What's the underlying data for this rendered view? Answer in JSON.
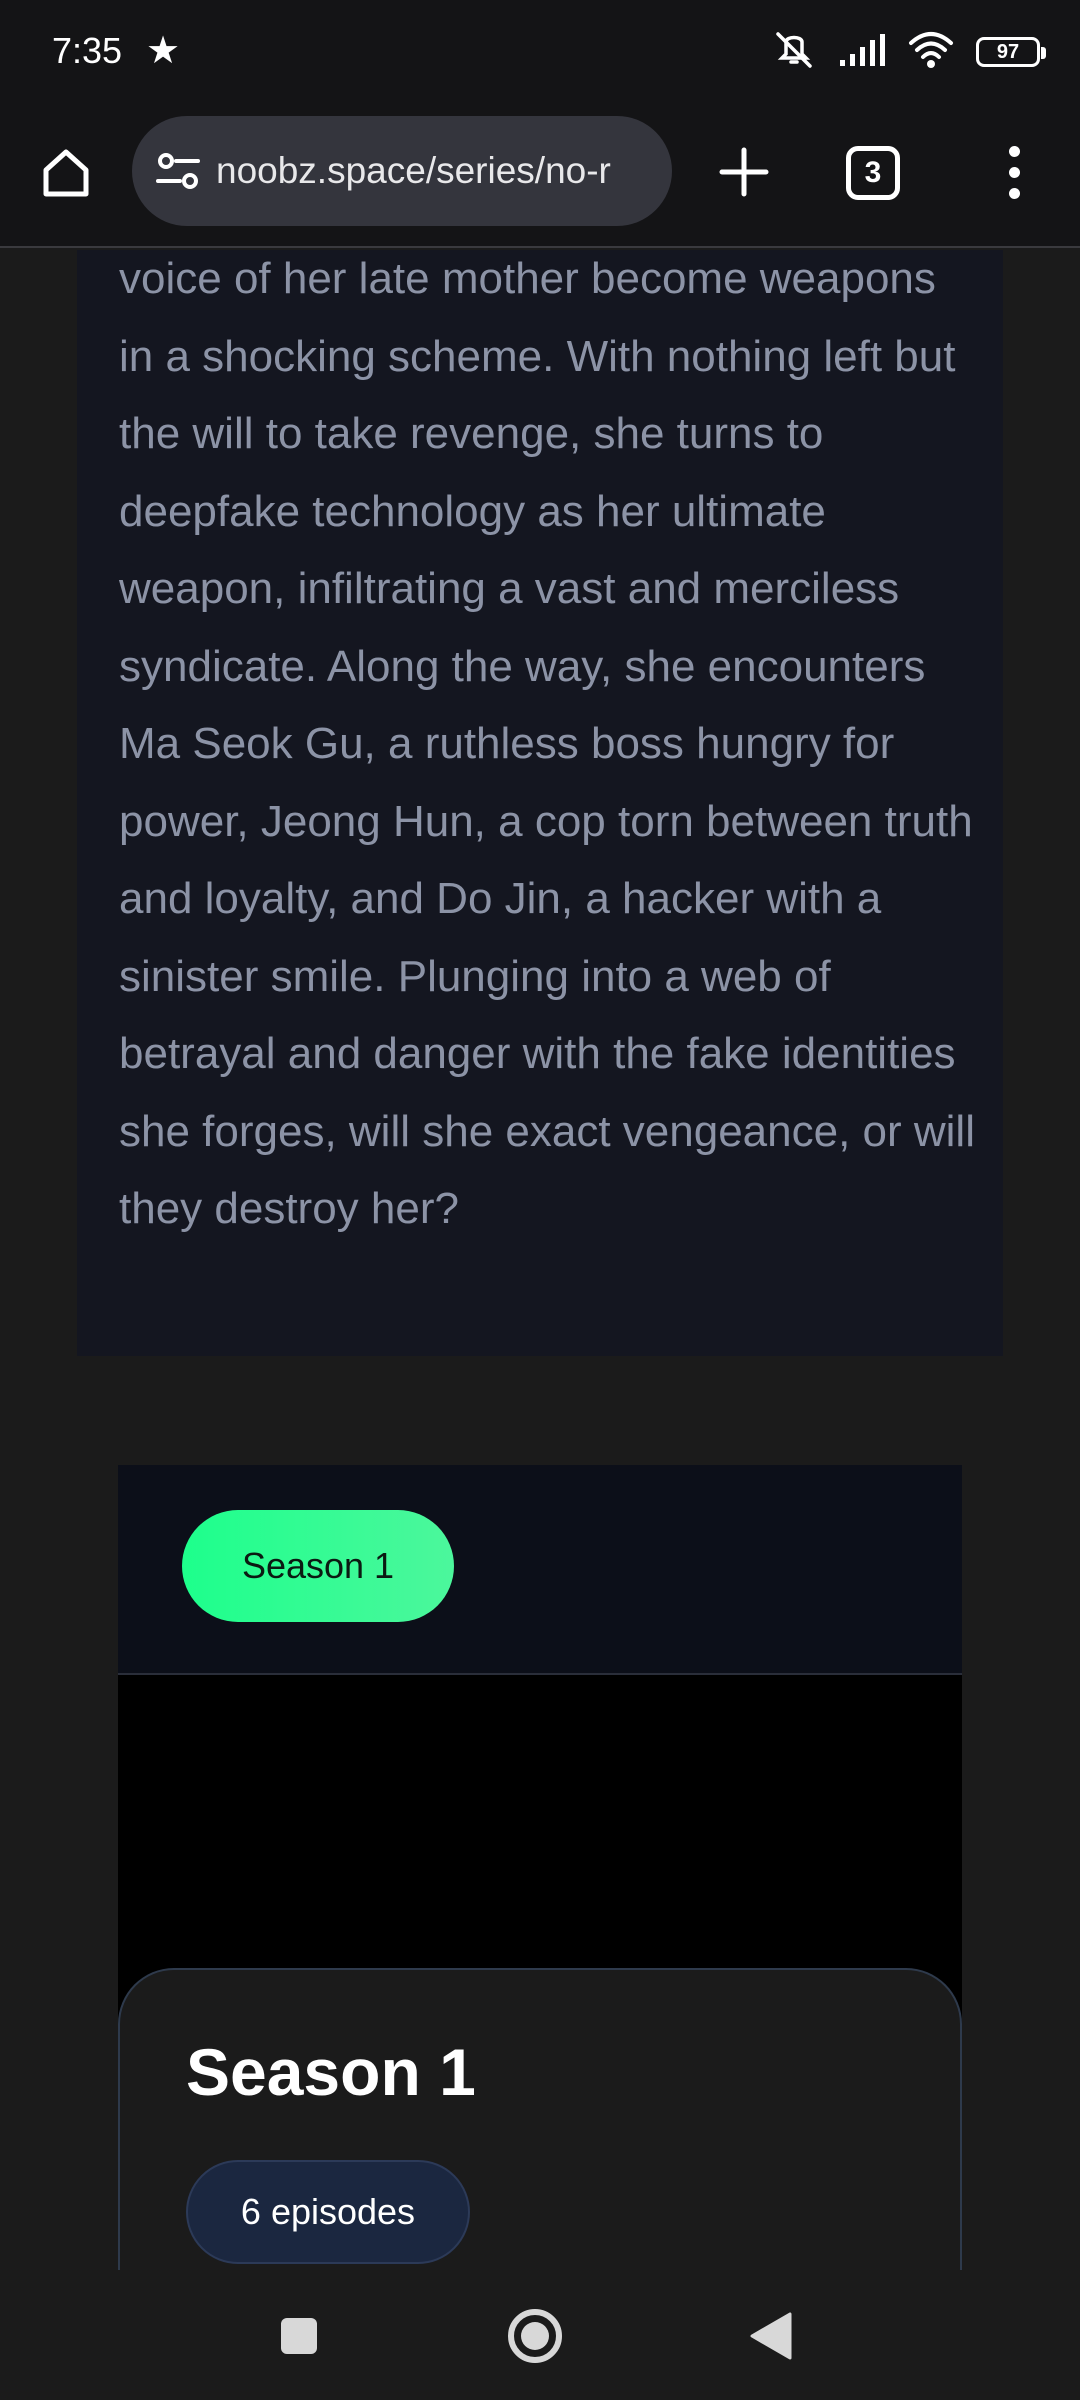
{
  "status_bar": {
    "time": "7:35",
    "battery": "97",
    "icons": [
      "star-icon",
      "vibrate-off-icon",
      "signal-icon",
      "wifi-icon",
      "battery-icon"
    ]
  },
  "toolbar": {
    "url": "noobz.space/series/no-r",
    "tab_count": "3",
    "icons": [
      "home-icon",
      "site-settings-icon",
      "new-tab-plus-icon",
      "tab-switcher-icon",
      "more-menu-icon"
    ]
  },
  "synopsis": {
    "text": "voice of her late mother become weapons in a shocking scheme. With nothing left but the will to take revenge, she turns to deepfake technology as her ultimate weapon, infiltrating a vast and merciless syndicate. Along the way, she encounters Ma Seok Gu, a ruthless boss hungry for power, Jeong Hun, a cop torn between truth and loyalty, and Do Jin, a hacker with a sinister smile. Plunging into a web of betrayal and danger with the fake identities she forges, will she exact vengeance, or will they destroy her?"
  },
  "seasons": {
    "selector": [
      "Season 1"
    ],
    "selected_title": "Season 1",
    "episode_count": "6 episodes"
  },
  "colors": {
    "accent": "#1dff8c",
    "card_bg": "#141620",
    "badge_bg": "#1b2740",
    "synopsis_text": "#8c93a6"
  },
  "nav_bar": {
    "icons": [
      "recents-square-icon",
      "home-circle-icon",
      "back-triangle-icon"
    ]
  }
}
